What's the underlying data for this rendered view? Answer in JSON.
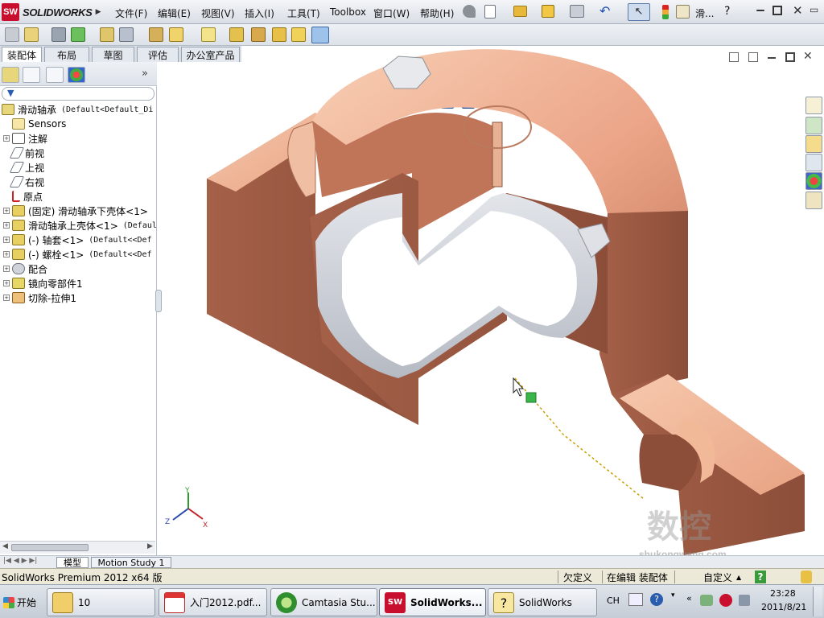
{
  "app": {
    "logo_text": "SOLIDWORKS",
    "logo_mark": "SW"
  },
  "menu": [
    "文件(F)",
    "编辑(E)",
    "视图(V)",
    "插入(I)",
    "工具(T)",
    "Toolbox",
    "窗口(W)",
    "帮助(H)"
  ],
  "title_short": "滑...",
  "help_mark": "?",
  "command_tabs": [
    {
      "label": "装配体",
      "active": true
    },
    {
      "label": "布局",
      "active": false
    },
    {
      "label": "草图",
      "active": false
    },
    {
      "label": "评估",
      "active": false
    },
    {
      "label": "办公室产品",
      "active": false
    }
  ],
  "panel_collapse": "»",
  "tree": {
    "root": {
      "label": "滑动轴承",
      "config": "(Default<Default_Di"
    },
    "items": [
      {
        "label": "Sensors",
        "expander": "",
        "config": "",
        "icon": "sensor-icon"
      },
      {
        "label": "注解",
        "expander": "+",
        "config": "",
        "icon": "annotation-icon"
      },
      {
        "label": "前视",
        "expander": "",
        "config": "",
        "icon": "plane-icon"
      },
      {
        "label": "上视",
        "expander": "",
        "config": "",
        "icon": "plane-icon"
      },
      {
        "label": "右视",
        "expander": "",
        "config": "",
        "icon": "plane-icon"
      },
      {
        "label": "原点",
        "expander": "",
        "config": "",
        "icon": "origin-icon"
      },
      {
        "label": "(固定) 滑动轴承下壳体<1>",
        "expander": "+",
        "config": "",
        "icon": "part-icon"
      },
      {
        "label": "滑动轴承上壳体<1>",
        "expander": "+",
        "config": "(Defaul",
        "icon": "part-icon"
      },
      {
        "label": "(-) 轴套<1>",
        "expander": "+",
        "config": "(Default<<Def",
        "icon": "part-icon"
      },
      {
        "label": "(-) 螺栓<1>",
        "expander": "+",
        "config": "(Default<<Def",
        "icon": "part-icon"
      },
      {
        "label": "配合",
        "expander": "+",
        "config": "",
        "icon": "mates-icon"
      },
      {
        "label": "镜向零部件1",
        "expander": "+",
        "config": "",
        "icon": "mirror-icon"
      },
      {
        "label": "切除-拉伸1",
        "expander": "+",
        "config": "",
        "icon": "cut-extrude-icon"
      }
    ]
  },
  "bottom_tabs": [
    {
      "label": "模型",
      "active": true
    },
    {
      "label": "Motion Study 1",
      "active": false
    }
  ],
  "status": {
    "product": "SolidWorks Premium 2012 x64 版",
    "definition": "欠定义",
    "mode": "在编辑 装配体",
    "units": "自定义",
    "units_arrow": "▲",
    "help": "?"
  },
  "taskbar": {
    "start": "开始",
    "tasks": [
      {
        "label": "10",
        "icon": "folder-icon"
      },
      {
        "label": "入门2012.pdf...",
        "icon": "pdf-icon"
      },
      {
        "label": "Camtasia Stu...",
        "icon": "camtasia-icon"
      },
      {
        "label": "SolidWorks...",
        "icon": "solidworks-icon"
      },
      {
        "label": "SolidWorks",
        "icon": "help-icon"
      }
    ],
    "lang": "CH",
    "time": "23:28",
    "date": "2011/8/21"
  },
  "triad": {
    "x": "X",
    "y": "Y",
    "z": "Z"
  },
  "watermark": {
    "line1": "数控",
    "line2": "shukongwang.com"
  },
  "colors": {
    "part_top": "#f0b598",
    "part_side": "#9c5a44",
    "part_dark": "#7e4533",
    "cut_gray": "#c8ccd4",
    "accent_red": "#c8102e"
  }
}
